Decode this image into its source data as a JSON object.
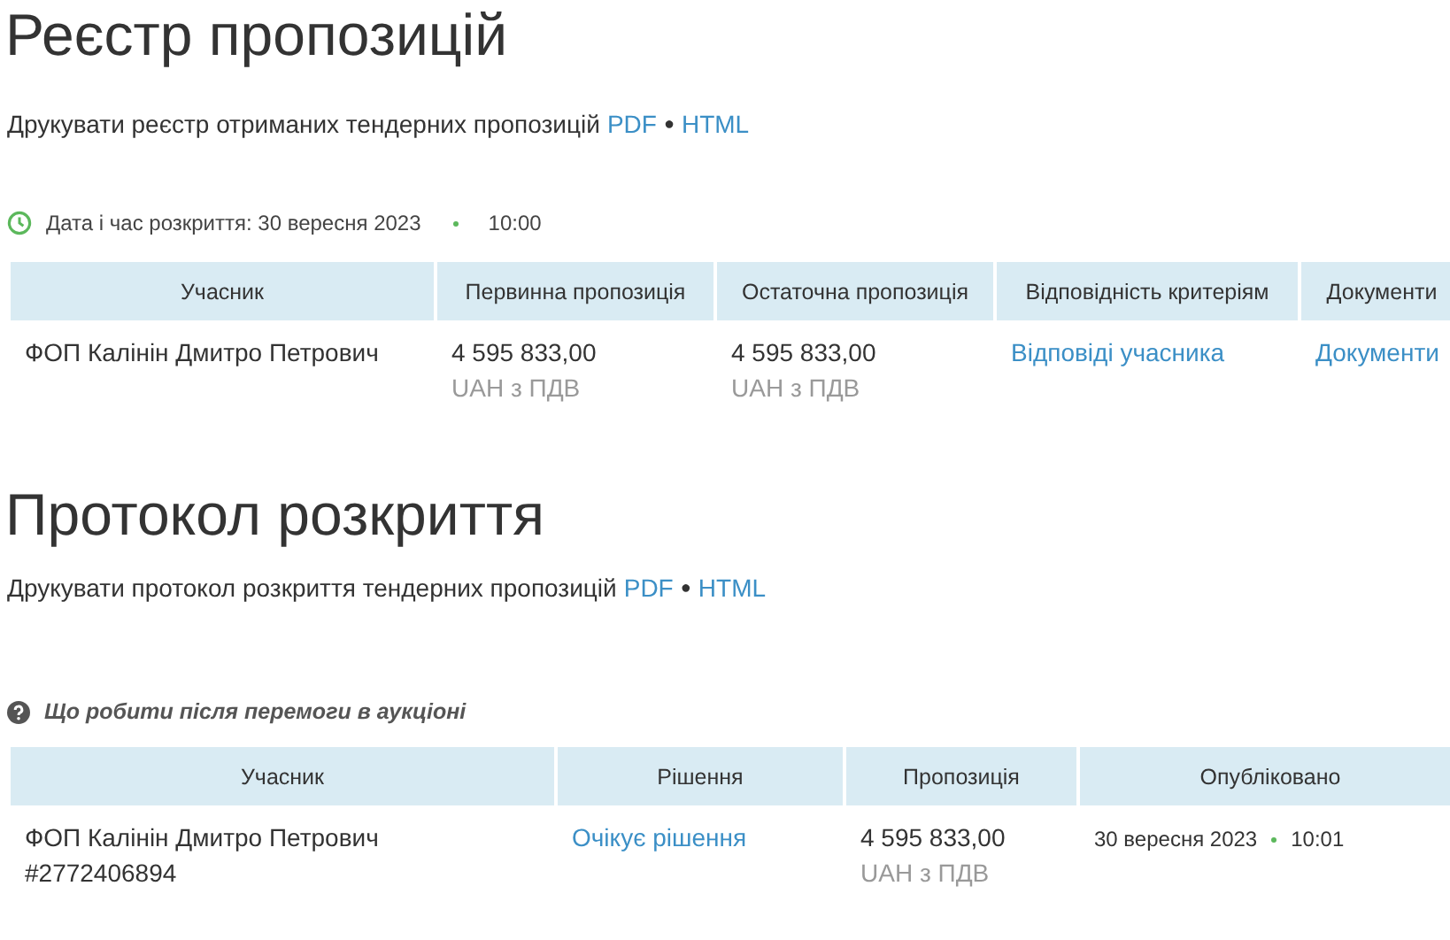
{
  "sections": [
    {
      "title": "Реєстр пропозицій",
      "print": {
        "text": "Друкувати реєстр отриманих тендерних пропозицій",
        "links": [
          "PDF",
          "HTML"
        ],
        "separator": "●"
      },
      "info": {
        "kind": "clock",
        "label": "Дата і час розкриття: 30 вересня 2023",
        "time": "10:00"
      },
      "table": {
        "columns": [
          "Учасник",
          "Первинна пропозиція",
          "Остаточна пропозиція",
          "Відповідність критеріям",
          "Документи"
        ],
        "rows": [
          {
            "cells": [
              {
                "kind": "text",
                "lines": [
                  "ФОП Калінін Дмитро Петрович"
                ]
              },
              {
                "kind": "amount",
                "value": "4 595 833,00",
                "currency": "UAH з ПДВ"
              },
              {
                "kind": "amount",
                "value": "4 595 833,00",
                "currency": "UAH з ПДВ"
              },
              {
                "kind": "link",
                "text": "Відповіді учасника"
              },
              {
                "kind": "link",
                "text": "Документи"
              }
            ]
          }
        ]
      }
    },
    {
      "title": "Протокол розкриття",
      "print": {
        "text": "Друкувати протокол розкриття тендерних пропозицій",
        "links": [
          "PDF",
          "HTML"
        ],
        "separator": "●"
      },
      "info": {
        "kind": "help",
        "label": "Що робити після перемоги в аукціоні"
      },
      "table": {
        "columns": [
          "Учасник",
          "Рішення",
          "Пропозиція",
          "Опубліковано"
        ],
        "rows": [
          {
            "cells": [
              {
                "kind": "text",
                "lines": [
                  "ФОП Калінін Дмитро Петрович",
                  "#2772406894"
                ]
              },
              {
                "kind": "link",
                "text": "Очікує рішення"
              },
              {
                "kind": "amount",
                "value": "4 595 833,00",
                "currency": "UAH з ПДВ"
              },
              {
                "kind": "datetime",
                "date": "30 вересня 2023",
                "time": "10:01"
              }
            ]
          }
        ]
      }
    }
  ]
}
